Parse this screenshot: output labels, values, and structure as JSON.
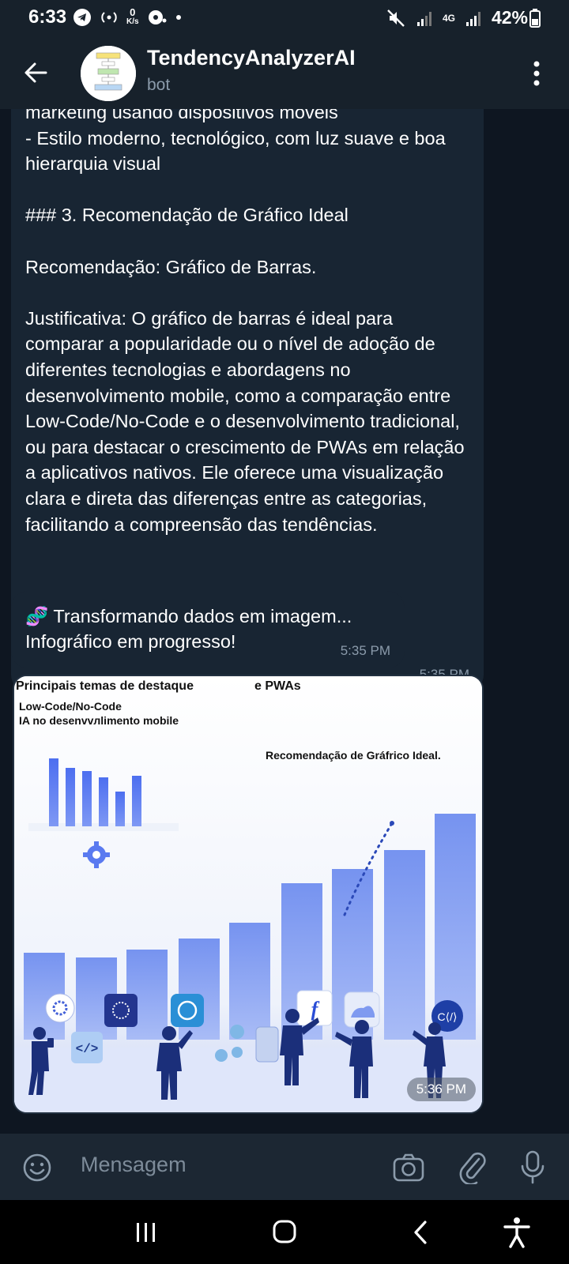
{
  "status_bar": {
    "time": "6:33",
    "data_rate_value": "0",
    "data_rate_unit": "K/s",
    "network": "4G",
    "battery": "42%"
  },
  "header": {
    "title": "TendencyAnalyzerAI",
    "subtitle": "bot"
  },
  "messages": [
    {
      "text": "marketing usando dispositivos móveis\n- Estilo moderno, tecnológico, com luz suave e boa hierarquia visual\n\n### 3. Recomendação de Gráfico Ideal\n\nRecomendação: Gráfico de Barras.\n\nJustificativa: O gráfico de barras é ideal para comparar a popularidade ou o nível de adoção de diferentes tecnologias e abordagens no desenvolvimento mobile, como a comparação entre Low-Code/No-Code e o desenvolvimento tradicional, ou para destacar o crescimento de PWAs em relação a aplicativos nativos. Ele oferece uma visualização clara e direta das diferenças entre as categorias, facilitando a compreensão das tendências.",
      "time": "5:35 PM"
    },
    {
      "emoji": "🧬",
      "text": "Transformando dados em imagem... Infográfico em progresso!",
      "time": "5:35 PM"
    },
    {
      "type": "image",
      "image_text": {
        "title": "Principais temas de destaque",
        "title_right": "e PWAs",
        "line1": "Low-Code/No-Code",
        "line2": "IA no desenvvлlimento mobile",
        "recommendation": "Recomendação de Gráfrico Ideal."
      },
      "time": "5:36 PM"
    }
  ],
  "input": {
    "placeholder": "Mensagem"
  },
  "colors": {
    "background": "#0e1621",
    "header": "#17212b",
    "bubble": "#182533",
    "meta_text": "#8b9bab",
    "bar_blue": "#6f8ef0"
  }
}
